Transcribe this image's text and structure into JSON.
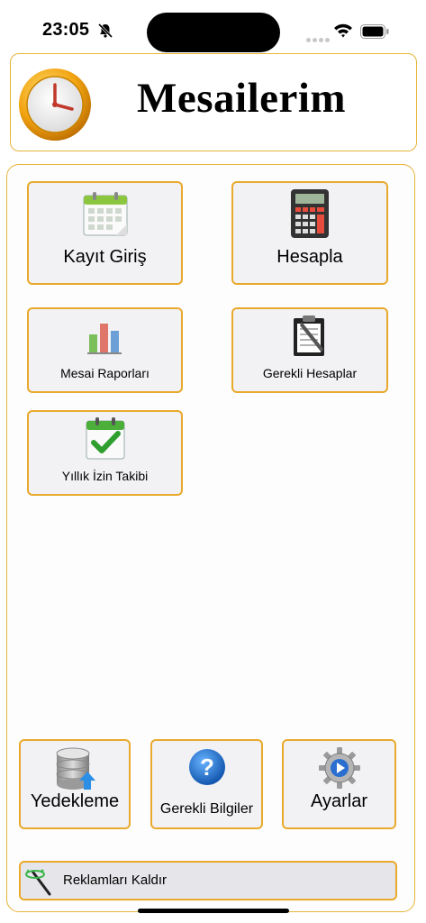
{
  "status_bar": {
    "time": "23:05"
  },
  "header": {
    "title": "Mesailerim"
  },
  "menu": {
    "kayit_giris": "Kayıt Giriş",
    "hesapla": "Hesapla",
    "mesai_raporlari": "Mesai Raporları",
    "gerekli_hesaplar": "Gerekli Hesaplar",
    "yillik_izin": "Yıllık İzin Takibi"
  },
  "bottom": {
    "yedekleme": "Yedekleme",
    "gerekli_bilgiler": "Gerekli Bilgiler",
    "ayarlar": "Ayarlar"
  },
  "ad": {
    "label": "Reklamları Kaldır"
  },
  "colors": {
    "accent_border": "#e9a92c",
    "tile_bg": "#f2f2f5"
  }
}
